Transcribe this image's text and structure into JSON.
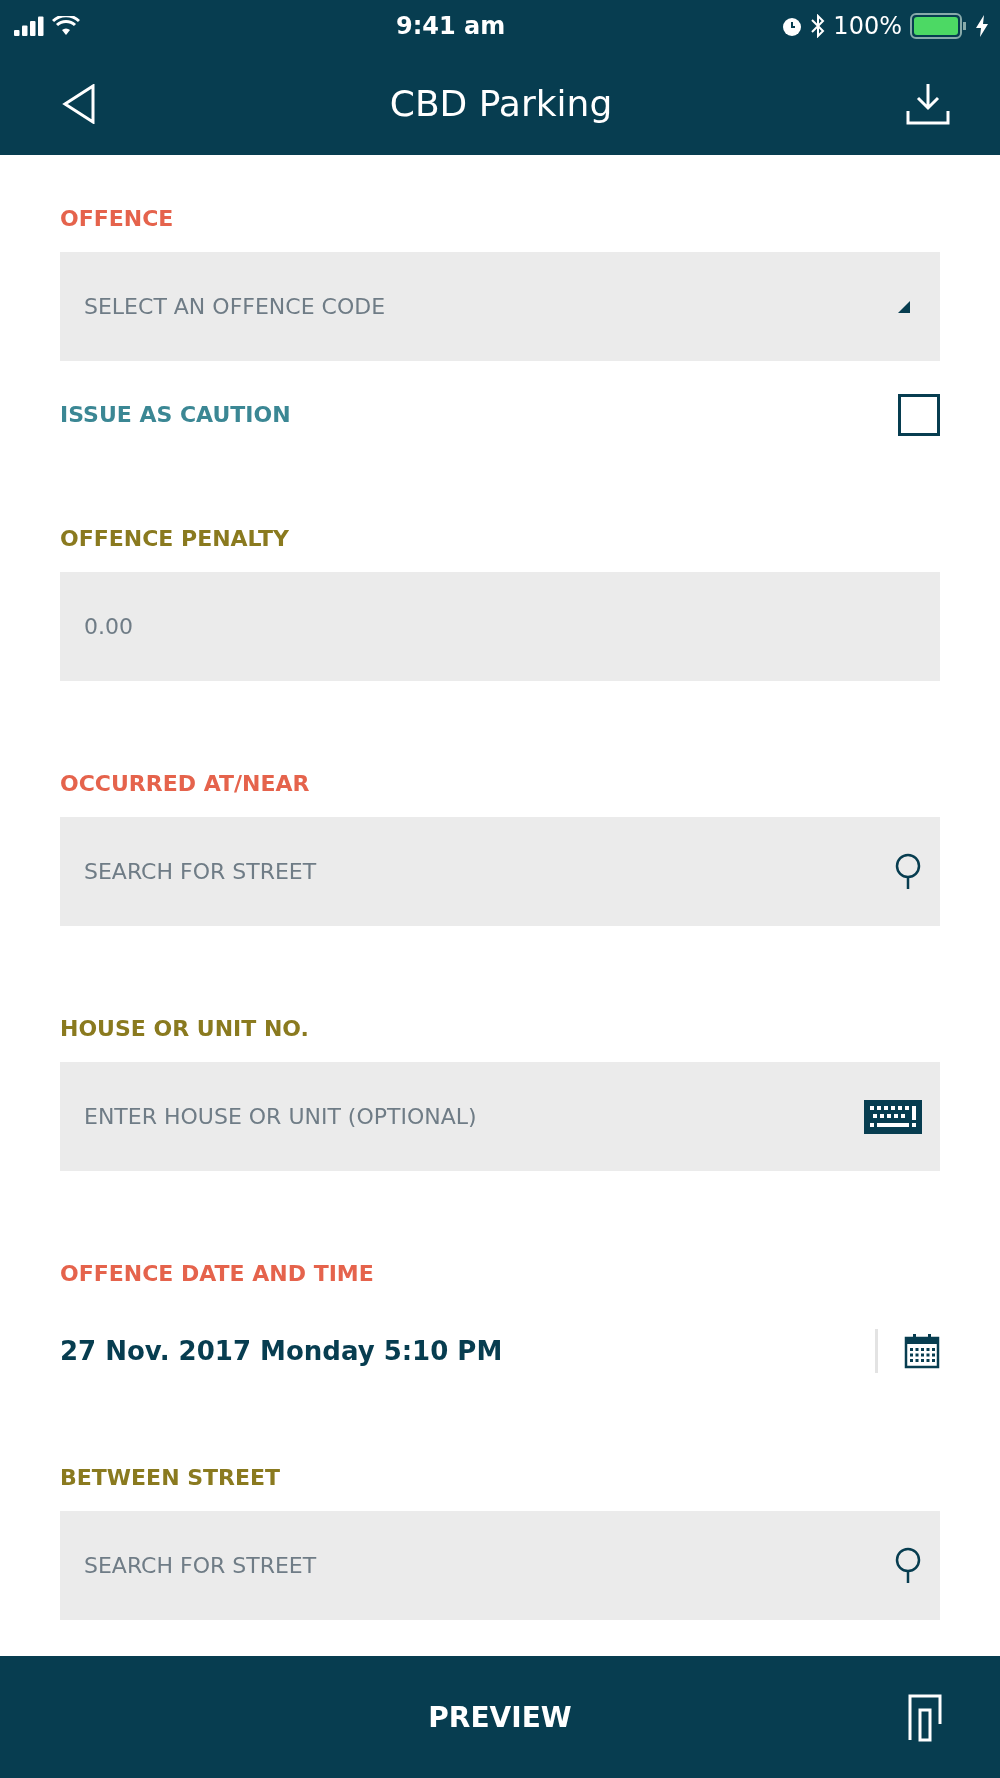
{
  "status_bar": {
    "time": "9:41 am",
    "battery": "100%"
  },
  "header": {
    "title": "CBD Parking"
  },
  "sections": [
    {
      "kind": "select",
      "label": "OFFENCE",
      "color": "#e5634c",
      "placeholder": "SELECT AN OFFENCE CODE"
    },
    {
      "kind": "checkbox",
      "label": "ISSUE AS CAUTION",
      "color": "#3b8794",
      "checked": false
    },
    {
      "kind": "input",
      "label": "OFFENCE PENALTY",
      "color": "#8a7a1f",
      "placeholder": "0.00"
    },
    {
      "kind": "search",
      "label": "OCCURRED AT/NEAR",
      "color": "#e5634c",
      "placeholder": "SEARCH FOR STREET"
    },
    {
      "kind": "keyboard",
      "label": "HOUSE OR UNIT NO.",
      "color": "#8a7a1f",
      "placeholder": "ENTER HOUSE OR UNIT (OPTIONAL)"
    },
    {
      "kind": "date",
      "label": "OFFENCE DATE AND TIME",
      "color": "#e5634c",
      "value": "27 Nov. 2017 Monday 5:10 PM"
    },
    {
      "kind": "search",
      "label": "BETWEEN STREET",
      "color": "#8a7a1f",
      "placeholder": "SEARCH FOR STREET"
    }
  ],
  "footer": {
    "button": "PREVIEW"
  }
}
